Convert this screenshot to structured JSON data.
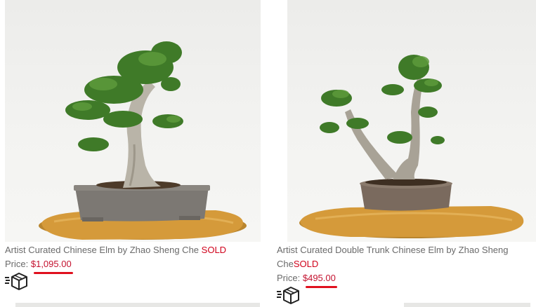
{
  "products": [
    {
      "title": "Artist Curated Chinese Elm by Zhao Sheng Che",
      "sold_label": "SOLD",
      "price_label": "Price:",
      "price": "$1,095.00",
      "shipping_icon": "shipping-box-icon",
      "image": "bonsai-chinese-elm-photo"
    },
    {
      "title": "Artist Curated Double Trunk Chinese Elm by Zhao Sheng Che",
      "sold_label": "SOLD",
      "price_label": "Price:",
      "price": "$495.00",
      "shipping_icon": "shipping-box-icon",
      "image": "bonsai-double-trunk-elm-photo"
    }
  ],
  "colors": {
    "sold": "#d0021b",
    "price": "#c4122f",
    "underline": "#e0101e",
    "text": "#6a6a6a"
  }
}
